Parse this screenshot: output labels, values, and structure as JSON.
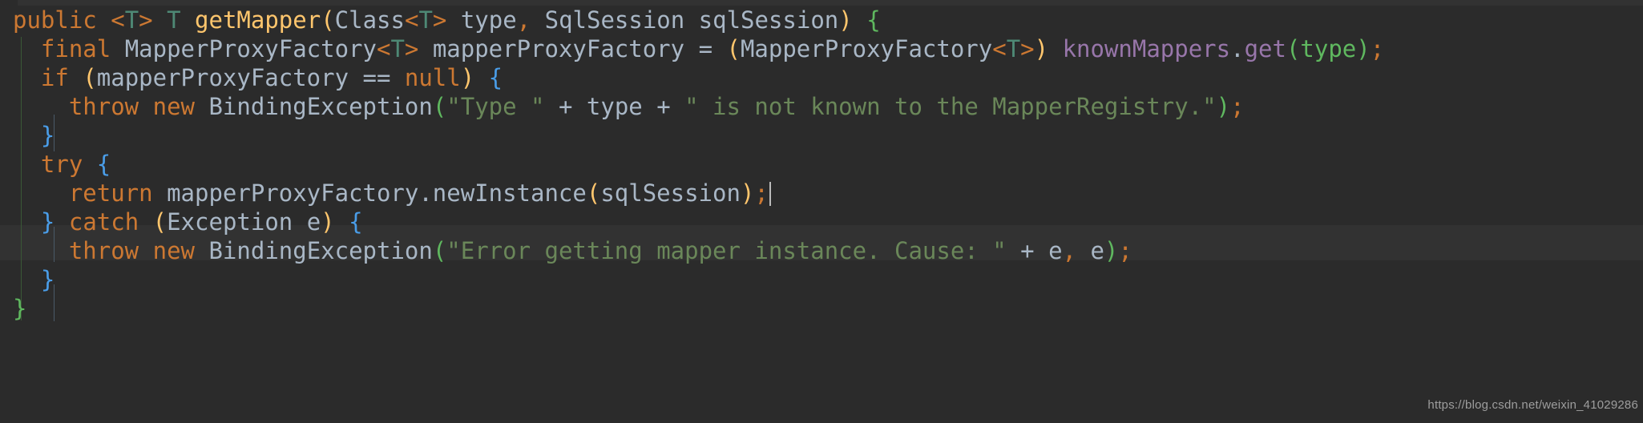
{
  "editor": {
    "theme": "darcula",
    "language": "java",
    "background_color": "#2b2b2b",
    "current_line_background": "#323232",
    "default_text_color": "#a9b7c6",
    "caret_color": "#bbbbbb",
    "current_line_number": 6,
    "colors": {
      "keyword": "#cc7832",
      "string": "#6a8759",
      "field": "#9876aa",
      "method_declaration": "#ffc66d",
      "generic_type": "#4e8975",
      "brace_blue": "#4a9de8",
      "brace_green": "#5fb85f",
      "paren_gold": "#ffc66d",
      "paren_green": "#5fb85f",
      "punctuation": "#cc7832",
      "indent_guide_method": "#3a5836",
      "indent_guide_block": "#4a5a68"
    },
    "lines": [
      {
        "n": 1,
        "text": "public <T> T getMapper(Class<T> type, SqlSession sqlSession) {",
        "tokens": [
          {
            "t": "public",
            "c": "kw"
          },
          {
            "t": " ",
            "c": "plain"
          },
          {
            "t": "<",
            "c": "kw"
          },
          {
            "t": "T",
            "c": "gen"
          },
          {
            "t": ">",
            "c": "kw"
          },
          {
            "t": " ",
            "c": "plain"
          },
          {
            "t": "T",
            "c": "gen"
          },
          {
            "t": " ",
            "c": "plain"
          },
          {
            "t": "getMapper",
            "c": "mth"
          },
          {
            "t": "(",
            "c": "par"
          },
          {
            "t": "Class",
            "c": "type"
          },
          {
            "t": "<",
            "c": "kw"
          },
          {
            "t": "T",
            "c": "gen"
          },
          {
            "t": ">",
            "c": "kw"
          },
          {
            "t": " type",
            "c": "type"
          },
          {
            "t": ",",
            "c": "pun"
          },
          {
            "t": " SqlSession sqlSession",
            "c": "type"
          },
          {
            "t": ")",
            "c": "par"
          },
          {
            "t": " ",
            "c": "plain"
          },
          {
            "t": "{",
            "c": "brcg"
          }
        ]
      },
      {
        "n": 2,
        "text": "  final MapperProxyFactory<T> mapperProxyFactory = (MapperProxyFactory<T>) knownMappers.get(type);",
        "tokens": [
          {
            "t": "  ",
            "c": "plain"
          },
          {
            "t": "final",
            "c": "kw"
          },
          {
            "t": " MapperProxyFactory",
            "c": "type"
          },
          {
            "t": "<",
            "c": "kw"
          },
          {
            "t": "T",
            "c": "gen"
          },
          {
            "t": ">",
            "c": "kw"
          },
          {
            "t": " mapperProxyFactory = ",
            "c": "type"
          },
          {
            "t": "(",
            "c": "par"
          },
          {
            "t": "MapperProxyFactory",
            "c": "type"
          },
          {
            "t": "<",
            "c": "kw"
          },
          {
            "t": "T",
            "c": "gen"
          },
          {
            "t": ">",
            "c": "kw"
          },
          {
            "t": ")",
            "c": "par"
          },
          {
            "t": " ",
            "c": "plain"
          },
          {
            "t": "knownMappers",
            "c": "fld"
          },
          {
            "t": ".",
            "c": "plain"
          },
          {
            "t": "get",
            "c": "fld"
          },
          {
            "t": "(",
            "c": "parg"
          },
          {
            "t": "type",
            "c": "parg"
          },
          {
            "t": ")",
            "c": "parg"
          },
          {
            "t": ";",
            "c": "pun"
          }
        ]
      },
      {
        "n": 3,
        "text": "  if (mapperProxyFactory == null) {",
        "tokens": [
          {
            "t": "  ",
            "c": "plain"
          },
          {
            "t": "if",
            "c": "kw"
          },
          {
            "t": " ",
            "c": "plain"
          },
          {
            "t": "(",
            "c": "par"
          },
          {
            "t": "mapperProxyFactory == ",
            "c": "type"
          },
          {
            "t": "null",
            "c": "kw"
          },
          {
            "t": ")",
            "c": "par"
          },
          {
            "t": " ",
            "c": "plain"
          },
          {
            "t": "{",
            "c": "brc"
          }
        ]
      },
      {
        "n": 4,
        "text": "    throw new BindingException(\"Type \" + type + \" is not known to the MapperRegistry.\");",
        "tokens": [
          {
            "t": "    ",
            "c": "plain"
          },
          {
            "t": "throw",
            "c": "kw"
          },
          {
            "t": " ",
            "c": "plain"
          },
          {
            "t": "new",
            "c": "kw"
          },
          {
            "t": " BindingException",
            "c": "type"
          },
          {
            "t": "(",
            "c": "parg"
          },
          {
            "t": "\"Type \"",
            "c": "str"
          },
          {
            "t": " + type + ",
            "c": "type"
          },
          {
            "t": "\" is not known to the MapperRegistry.\"",
            "c": "str"
          },
          {
            "t": ")",
            "c": "parg"
          },
          {
            "t": ";",
            "c": "pun"
          }
        ]
      },
      {
        "n": 5,
        "text": "  }",
        "tokens": [
          {
            "t": "  ",
            "c": "plain"
          },
          {
            "t": "}",
            "c": "brc"
          }
        ]
      },
      {
        "n": 6,
        "text": "  try {",
        "tokens": [
          {
            "t": "  ",
            "c": "plain"
          },
          {
            "t": "try",
            "c": "kw"
          },
          {
            "t": " ",
            "c": "plain"
          },
          {
            "t": "{",
            "c": "brc"
          }
        ]
      },
      {
        "n": 7,
        "text": "    return mapperProxyFactory.newInstance(sqlSession);",
        "current": true,
        "caret_after": ";",
        "tokens": [
          {
            "t": "    ",
            "c": "plain"
          },
          {
            "t": "return",
            "c": "kw"
          },
          {
            "t": " mapperProxyFactory.newInstance",
            "c": "type"
          },
          {
            "t": "(",
            "c": "par"
          },
          {
            "t": "sqlSession",
            "c": "type"
          },
          {
            "t": ")",
            "c": "par"
          },
          {
            "t": ";",
            "c": "pun"
          }
        ]
      },
      {
        "n": 8,
        "text": "  } catch (Exception e) {",
        "tokens": [
          {
            "t": "  ",
            "c": "plain"
          },
          {
            "t": "}",
            "c": "brc"
          },
          {
            "t": " ",
            "c": "plain"
          },
          {
            "t": "catch",
            "c": "kw"
          },
          {
            "t": " ",
            "c": "plain"
          },
          {
            "t": "(",
            "c": "par"
          },
          {
            "t": "Exception e",
            "c": "type"
          },
          {
            "t": ")",
            "c": "par"
          },
          {
            "t": " ",
            "c": "plain"
          },
          {
            "t": "{",
            "c": "brc"
          }
        ]
      },
      {
        "n": 9,
        "text": "    throw new BindingException(\"Error getting mapper instance. Cause: \" + e, e);",
        "tokens": [
          {
            "t": "    ",
            "c": "plain"
          },
          {
            "t": "throw",
            "c": "kw"
          },
          {
            "t": " ",
            "c": "plain"
          },
          {
            "t": "new",
            "c": "kw"
          },
          {
            "t": " BindingException",
            "c": "type"
          },
          {
            "t": "(",
            "c": "parg"
          },
          {
            "t": "\"Error getting mapper instance. Cause: \"",
            "c": "str"
          },
          {
            "t": " + e",
            "c": "type"
          },
          {
            "t": ",",
            "c": "pun"
          },
          {
            "t": " e",
            "c": "type"
          },
          {
            "t": ")",
            "c": "parg"
          },
          {
            "t": ";",
            "c": "pun"
          }
        ]
      },
      {
        "n": 10,
        "text": "  }",
        "tokens": [
          {
            "t": "  ",
            "c": "plain"
          },
          {
            "t": "}",
            "c": "brc"
          }
        ]
      },
      {
        "n": 11,
        "text": "}",
        "tokens": [
          {
            "t": "}",
            "c": "brcg"
          }
        ]
      }
    ]
  },
  "watermark": {
    "text": "https://blog.csdn.net/weixin_41029286",
    "color": "#9d9d9d"
  }
}
